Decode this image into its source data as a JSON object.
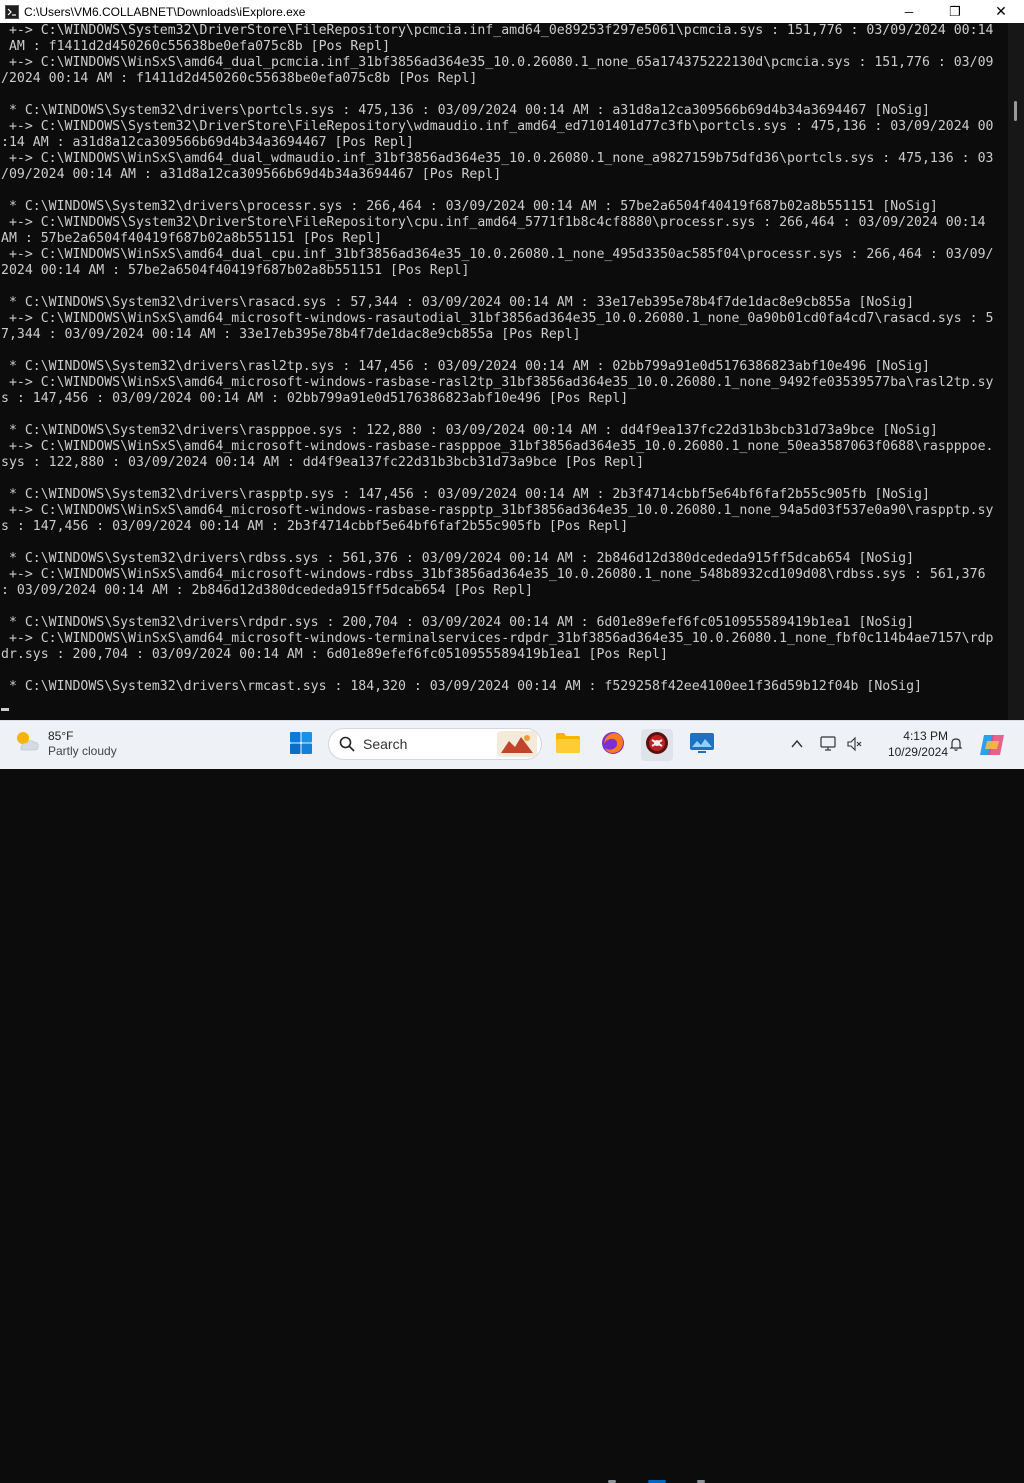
{
  "window": {
    "title": "C:\\Users\\VM6.COLLABNET\\Downloads\\iExplore.exe",
    "minimize_glyph": "─",
    "maximize_glyph": "❐",
    "close_glyph": "✕"
  },
  "console": {
    "lines": [
      " +-> C:\\WINDOWS\\System32\\DriverStore\\FileRepository\\pcmcia.inf_amd64_0e89253f297e5061\\pcmcia.sys : 151,776 : 03/09/2024 00:14",
      " AM : f1411d2d450260c55638be0efa075c8b [Pos Repl]",
      " +-> C:\\WINDOWS\\WinSxS\\amd64_dual_pcmcia.inf_31bf3856ad364e35_10.0.26080.1_none_65a174375222130d\\pcmcia.sys : 151,776 : 03/09",
      "/2024 00:14 AM : f1411d2d450260c55638be0efa075c8b [Pos Repl]",
      "",
      " * C:\\WINDOWS\\System32\\drivers\\portcls.sys : 475,136 : 03/09/2024 00:14 AM : a31d8a12ca309566b69d4b34a3694467 [NoSig]",
      " +-> C:\\WINDOWS\\System32\\DriverStore\\FileRepository\\wdmaudio.inf_amd64_ed7101401d77c3fb\\portcls.sys : 475,136 : 03/09/2024 00",
      ":14 AM : a31d8a12ca309566b69d4b34a3694467 [Pos Repl]",
      " +-> C:\\WINDOWS\\WinSxS\\amd64_dual_wdmaudio.inf_31bf3856ad364e35_10.0.26080.1_none_a9827159b75dfd36\\portcls.sys : 475,136 : 03",
      "/09/2024 00:14 AM : a31d8a12ca309566b69d4b34a3694467 [Pos Repl]",
      "",
      " * C:\\WINDOWS\\System32\\drivers\\processr.sys : 266,464 : 03/09/2024 00:14 AM : 57be2a6504f40419f687b02a8b551151 [NoSig]",
      " +-> C:\\WINDOWS\\System32\\DriverStore\\FileRepository\\cpu.inf_amd64_5771f1b8c4cf8880\\processr.sys : 266,464 : 03/09/2024 00:14",
      "AM : 57be2a6504f40419f687b02a8b551151 [Pos Repl]",
      " +-> C:\\WINDOWS\\WinSxS\\amd64_dual_cpu.inf_31bf3856ad364e35_10.0.26080.1_none_495d3350ac585f04\\processr.sys : 266,464 : 03/09/",
      "2024 00:14 AM : 57be2a6504f40419f687b02a8b551151 [Pos Repl]",
      "",
      " * C:\\WINDOWS\\System32\\drivers\\rasacd.sys : 57,344 : 03/09/2024 00:14 AM : 33e17eb395e78b4f7de1dac8e9cb855a [NoSig]",
      " +-> C:\\WINDOWS\\WinSxS\\amd64_microsoft-windows-rasautodial_31bf3856ad364e35_10.0.26080.1_none_0a90b01cd0fa4cd7\\rasacd.sys : 5",
      "7,344 : 03/09/2024 00:14 AM : 33e17eb395e78b4f7de1dac8e9cb855a [Pos Repl]",
      "",
      " * C:\\WINDOWS\\System32\\drivers\\rasl2tp.sys : 147,456 : 03/09/2024 00:14 AM : 02bb799a91e0d5176386823abf10e496 [NoSig]",
      " +-> C:\\WINDOWS\\WinSxS\\amd64_microsoft-windows-rasbase-rasl2tp_31bf3856ad364e35_10.0.26080.1_none_9492fe03539577ba\\rasl2tp.sy",
      "s : 147,456 : 03/09/2024 00:14 AM : 02bb799a91e0d5176386823abf10e496 [Pos Repl]",
      "",
      " * C:\\WINDOWS\\System32\\drivers\\raspppoe.sys : 122,880 : 03/09/2024 00:14 AM : dd4f9ea137fc22d31b3bcb31d73a9bce [NoSig]",
      " +-> C:\\WINDOWS\\WinSxS\\amd64_microsoft-windows-rasbase-raspppoe_31bf3856ad364e35_10.0.26080.1_none_50ea3587063f0688\\raspppoe.",
      "sys : 122,880 : 03/09/2024 00:14 AM : dd4f9ea137fc22d31b3bcb31d73a9bce [Pos Repl]",
      "",
      " * C:\\WINDOWS\\System32\\drivers\\raspptp.sys : 147,456 : 03/09/2024 00:14 AM : 2b3f4714cbbf5e64bf6faf2b55c905fb [NoSig]",
      " +-> C:\\WINDOWS\\WinSxS\\amd64_microsoft-windows-rasbase-raspptp_31bf3856ad364e35_10.0.26080.1_none_94a5d03f537e0a90\\raspptp.sy",
      "s : 147,456 : 03/09/2024 00:14 AM : 2b3f4714cbbf5e64bf6faf2b55c905fb [Pos Repl]",
      "",
      " * C:\\WINDOWS\\System32\\drivers\\rdbss.sys : 561,376 : 03/09/2024 00:14 AM : 2b846d12d380dcededa915ff5dcab654 [NoSig]",
      " +-> C:\\WINDOWS\\WinSxS\\amd64_microsoft-windows-rdbss_31bf3856ad364e35_10.0.26080.1_none_548b8932cd109d08\\rdbss.sys : 561,376",
      ": 03/09/2024 00:14 AM : 2b846d12d380dcededa915ff5dcab654 [Pos Repl]",
      "",
      " * C:\\WINDOWS\\System32\\drivers\\rdpdr.sys : 200,704 : 03/09/2024 00:14 AM : 6d01e89efef6fc0510955589419b1ea1 [NoSig]",
      " +-> C:\\WINDOWS\\WinSxS\\amd64_microsoft-windows-terminalservices-rdpdr_31bf3856ad364e35_10.0.26080.1_none_fbf0c114b4ae7157\\rdp",
      "dr.sys : 200,704 : 03/09/2024 00:14 AM : 6d01e89efef6fc0510955589419b1ea1 [Pos Repl]",
      "",
      " * C:\\WINDOWS\\System32\\drivers\\rmcast.sys : 184,320 : 03/09/2024 00:14 AM : f529258f42ee4100ee1f36d59b12f04b [NoSig]"
    ]
  },
  "taskbar": {
    "weather": {
      "temp": "85°F",
      "condition": "Partly cloudy"
    },
    "search": {
      "label": "Search"
    },
    "clock": {
      "time": "4:13 PM",
      "date": "10/29/2024"
    },
    "accent": "#0067c0"
  }
}
